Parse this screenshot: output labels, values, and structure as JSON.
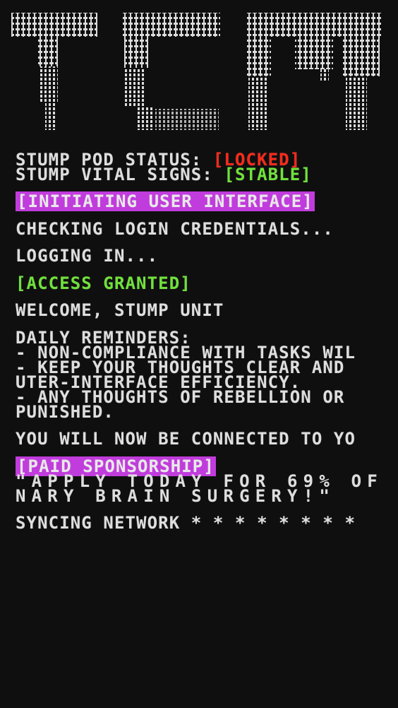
{
  "logo": {
    "name": "tcm-ascii-logo",
    "color": "#dcdcdc"
  },
  "status": {
    "pod_label": "STUMP POD STATUS: ",
    "pod_value": "[LOCKED]",
    "vitals_label": "STUMP VITAL SIGNS: ",
    "vitals_value": "[STABLE]"
  },
  "boot": {
    "initiating": "[INITIATING USER INTERFACE]",
    "checking": "CHECKING LOGIN CREDENTIALS...",
    "logging": "LOGGING IN...",
    "granted": "[ACCESS GRANTED]",
    "welcome": "WELCOME, STUMP UNIT"
  },
  "reminders": {
    "heading": "DAILY REMINDERS:",
    "line1": "- NON-COMPLIANCE WITH TASKS WIL",
    "line2": "- KEEP YOUR THOUGHTS CLEAR AND",
    "line3": "UTER-INTERFACE EFFICIENCY.",
    "line4": "- ANY THOUGHTS OF REBELLION OR",
    "line5": "PUNISHED."
  },
  "connect": {
    "text": "YOU WILL NOW BE CONNECTED TO YO"
  },
  "sponsor": {
    "label": "[PAID SPONSORSHIP]",
    "line1": "\"APPLY TODAY FOR 69% OF",
    "line2": "NARY BRAIN SURGERY!\""
  },
  "sync": {
    "text": "SYNCING NETWORK * * * * * * * *"
  },
  "colors": {
    "background": "#0f0f0f",
    "text": "#dedede",
    "locked": "#ff2a1a",
    "stable": "#6fe23a",
    "highlight": "#c13cdc"
  }
}
